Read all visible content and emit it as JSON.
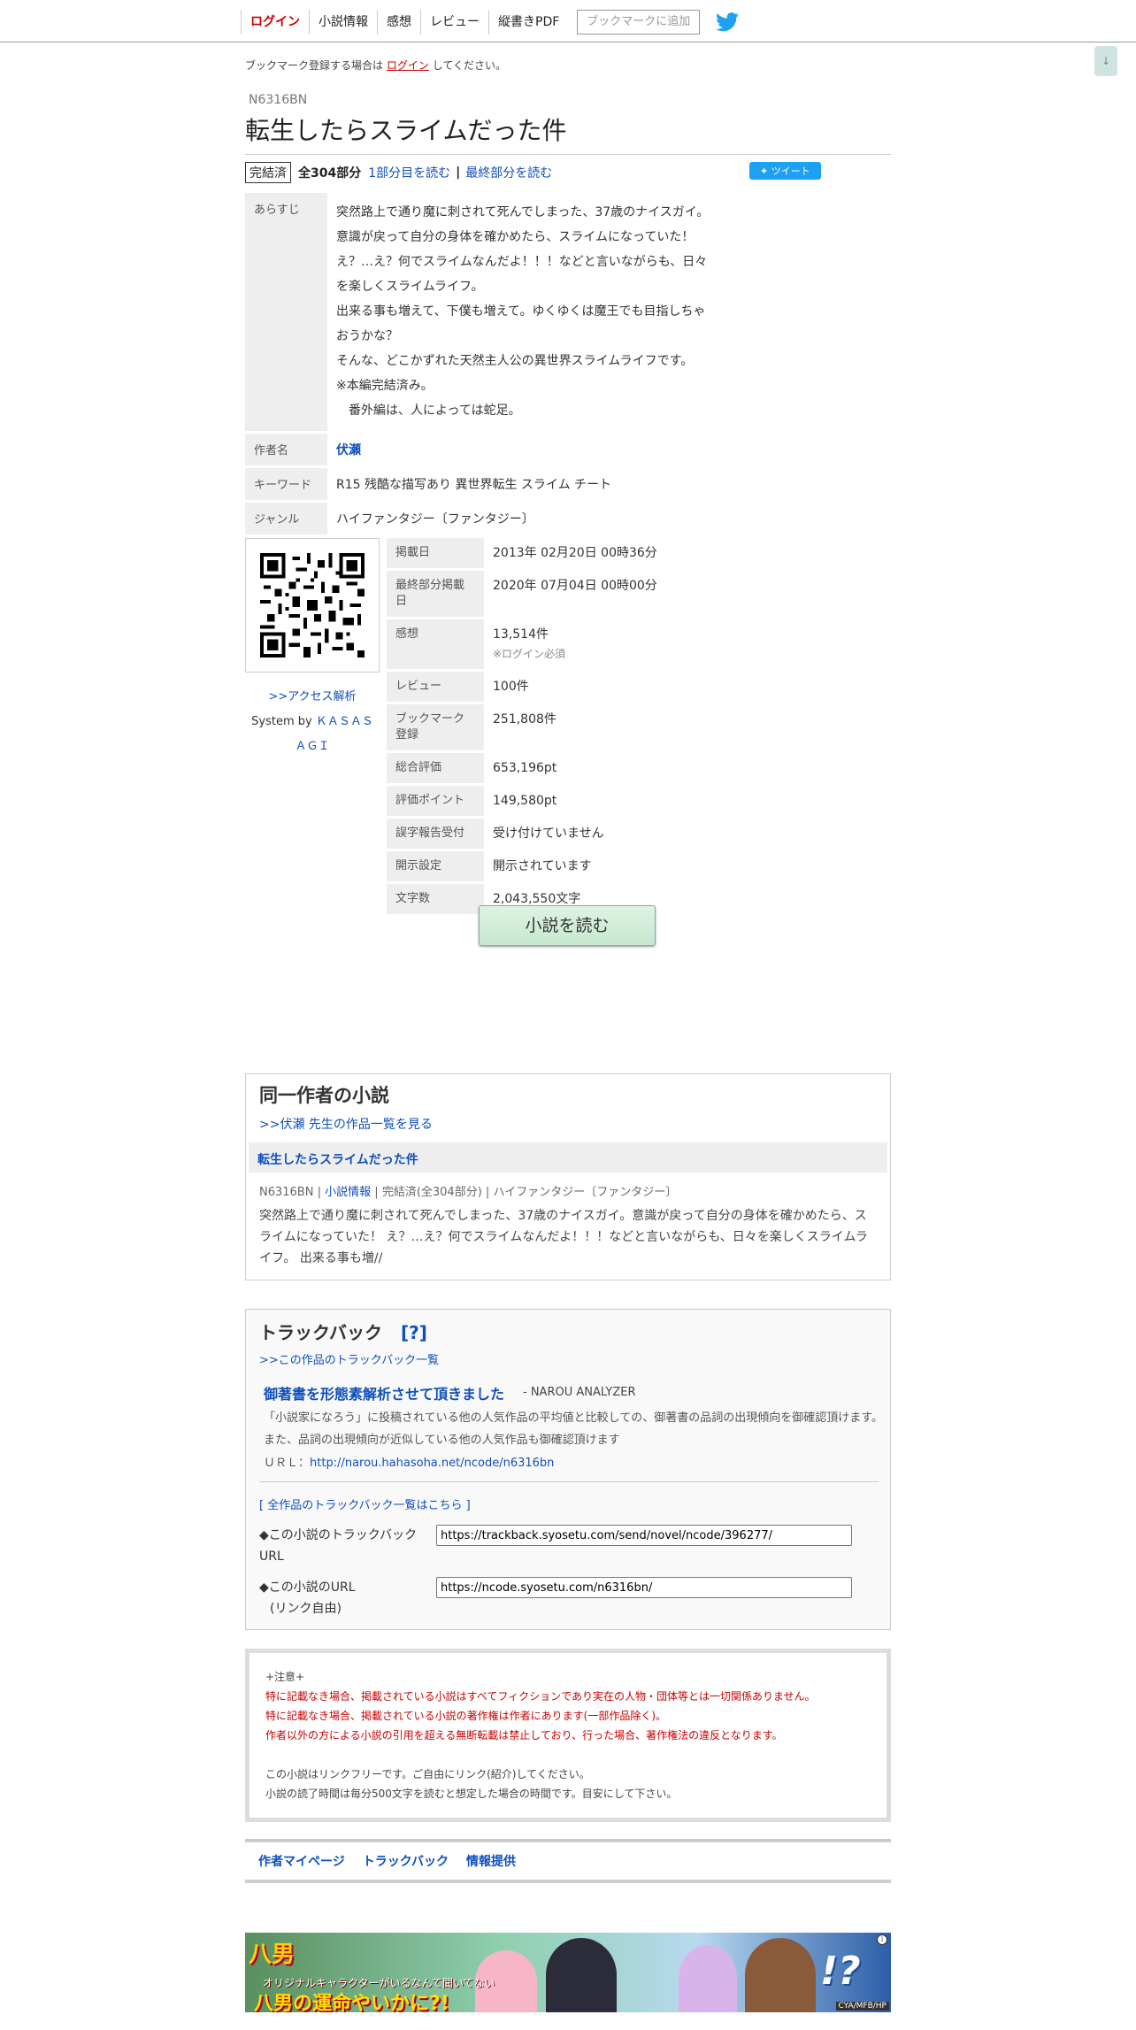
{
  "nav": {
    "items": [
      "ログイン",
      "小説情報",
      "感想",
      "レビュー",
      "縦書きPDF"
    ],
    "bookmark_button": "ブックマークに追加",
    "twitter_icon": "twitter-bird-icon",
    "scroll_button": "↓"
  },
  "login_note": {
    "prefix": "ブックマーク登録する場合は",
    "link": "ログイン",
    "suffix": "してください。"
  },
  "novel": {
    "ncode": "N6316BN",
    "title": "転生したらスライムだった件",
    "status": "完結済",
    "parts": "全304部分",
    "read_first": "1部分目を読む",
    "separator": "|",
    "read_last": "最終部分を読む",
    "tweet": "ツイート"
  },
  "info": {
    "synopsis_label": "あらすじ",
    "synopsis_lines": [
      "突然路上で通り魔に刺されて死んでしまった、37歳のナイスガイ。",
      "意識が戻って自分の身体を確かめたら、スライムになっていた！",
      "え？…え？何でスライムなんだよ！！！などと言いながらも、日々",
      "を楽しくスライムライフ。",
      "出来る事も増えて、下僕も増えて。ゆくゆくは魔王でも目指しちゃ",
      "おうかな？",
      "そんな、どこかずれた天然主人公の異世界スライムライフです。",
      "※本編完結済み。",
      "　番外編は、人によっては蛇足。"
    ],
    "author_label": "作者名",
    "author": "伏瀬",
    "keyword_label": "キーワード",
    "keywords": "R15 残酷な描写あり 異世界転生 スライム チート",
    "genre_label": "ジャンル",
    "genre": "ハイファンタジー〔ファンタジー〕"
  },
  "side": {
    "access_link": ">>アクセス解析",
    "system_by": "System by",
    "system_name_1": "ＫＡＳＡＳ",
    "system_name_2": "ＡＧＩ"
  },
  "stats": [
    {
      "label": "掲載日",
      "value": "2013年 02月20日 00時36分"
    },
    {
      "label": "最終部分掲載日",
      "value": "2020年 07月04日 00時00分"
    },
    {
      "label": "感想",
      "value": "13,514件",
      "note": "※ログイン必須"
    },
    {
      "label": "レビュー",
      "value": "100件"
    },
    {
      "label": "ブックマーク登録",
      "value": "251,808件"
    },
    {
      "label": "総合評価",
      "value": "653,196pt"
    },
    {
      "label": "評価ポイント",
      "value": "149,580pt"
    },
    {
      "label": "誤字報告受付",
      "value": "受け付けていません"
    },
    {
      "label": "開示設定",
      "value": "開示されています"
    },
    {
      "label": "文字数",
      "value": "2,043,550文字"
    }
  ],
  "read_button": "小説を読む",
  "same_author": {
    "heading": "同一作者の小説",
    "list_link": ">>伏瀬 先生の作品一覧を見る",
    "item_title": "転生したらスライムだった件",
    "meta_ncode": "N6316BN",
    "meta_sep": "|",
    "meta_link": "小説情報",
    "meta_status": "完結済(全304部分)",
    "meta_genre": "ハイファンタジー〔ファンタジー〕",
    "desc": "突然路上で通り魔に刺されて死んでしまった、37歳のナイスガイ。意識が戻って自分の身体を確かめたら、スライムになっていた！ え？…え？何でスライムなんだよ！！！などと言いながらも、日々を楽しくスライムライフ。 出来る事も増//"
  },
  "trackback": {
    "heading": "トラックバック",
    "help_open": "[",
    "help": "?",
    "help_close": "]",
    "list_link": ">>この作品のトラックバック一覧",
    "entry_title": "御著書を形態素解析させて頂きました",
    "entry_site": "- NAROU ANALYZER",
    "entry_desc": "「小説家になろう」に投稿されている他の人気作品の平均値と比較しての、御著書の品詞の出現傾向を御確認頂けます。また、品詞の出現傾向が近似している他の人気作品も御確認頂けます",
    "entry_url_label": "ＵＲＬ：",
    "entry_url": "http://narou.hahasoha.net/ncode/n6316bn",
    "all_link": "[ 全作品のトラックバック一覧はこちら ]",
    "tb_url_label_1": "◆この小説のトラックバック",
    "tb_url_label_2": "URL",
    "tb_url_value": "https://trackback.syosetu.com/send/novel/ncode/396277/",
    "novel_url_label_1": "◆この小説のURL",
    "novel_url_label_2": "(リンク自由)",
    "novel_url_value": "https://ncode.syosetu.com/n6316bn/"
  },
  "notice": {
    "head": "+注意+",
    "red_lines": [
      "特に記載なき場合、掲載されている小説はすべてフィクションであり実在の人物・団体等とは一切関係ありません。",
      "特に記載なき場合、掲載されている小説の著作権は作者にあります(一部作品除く)。",
      "作者以外の方による小説の引用を超える無断転載は禁止しており、行った場合、著作権法の違反となります。"
    ],
    "gray_lines": [
      "この小説はリンクフリーです。ご自由にリンク(紹介)してください。",
      "小説の読了時間は毎分500文字を読むと想定した場合の時間です。目安にして下さい。"
    ]
  },
  "footer_nav": [
    "作者マイページ",
    "トラックバック",
    "情報提供"
  ],
  "banner": {
    "title": "八男",
    "sub": "オリジナルキャラクターがいるなんて聞いてない",
    "main": "八男の運命やいかに?!",
    "logo": "!?",
    "credit": "CYA/MFB/HP",
    "info_mark": "i"
  }
}
